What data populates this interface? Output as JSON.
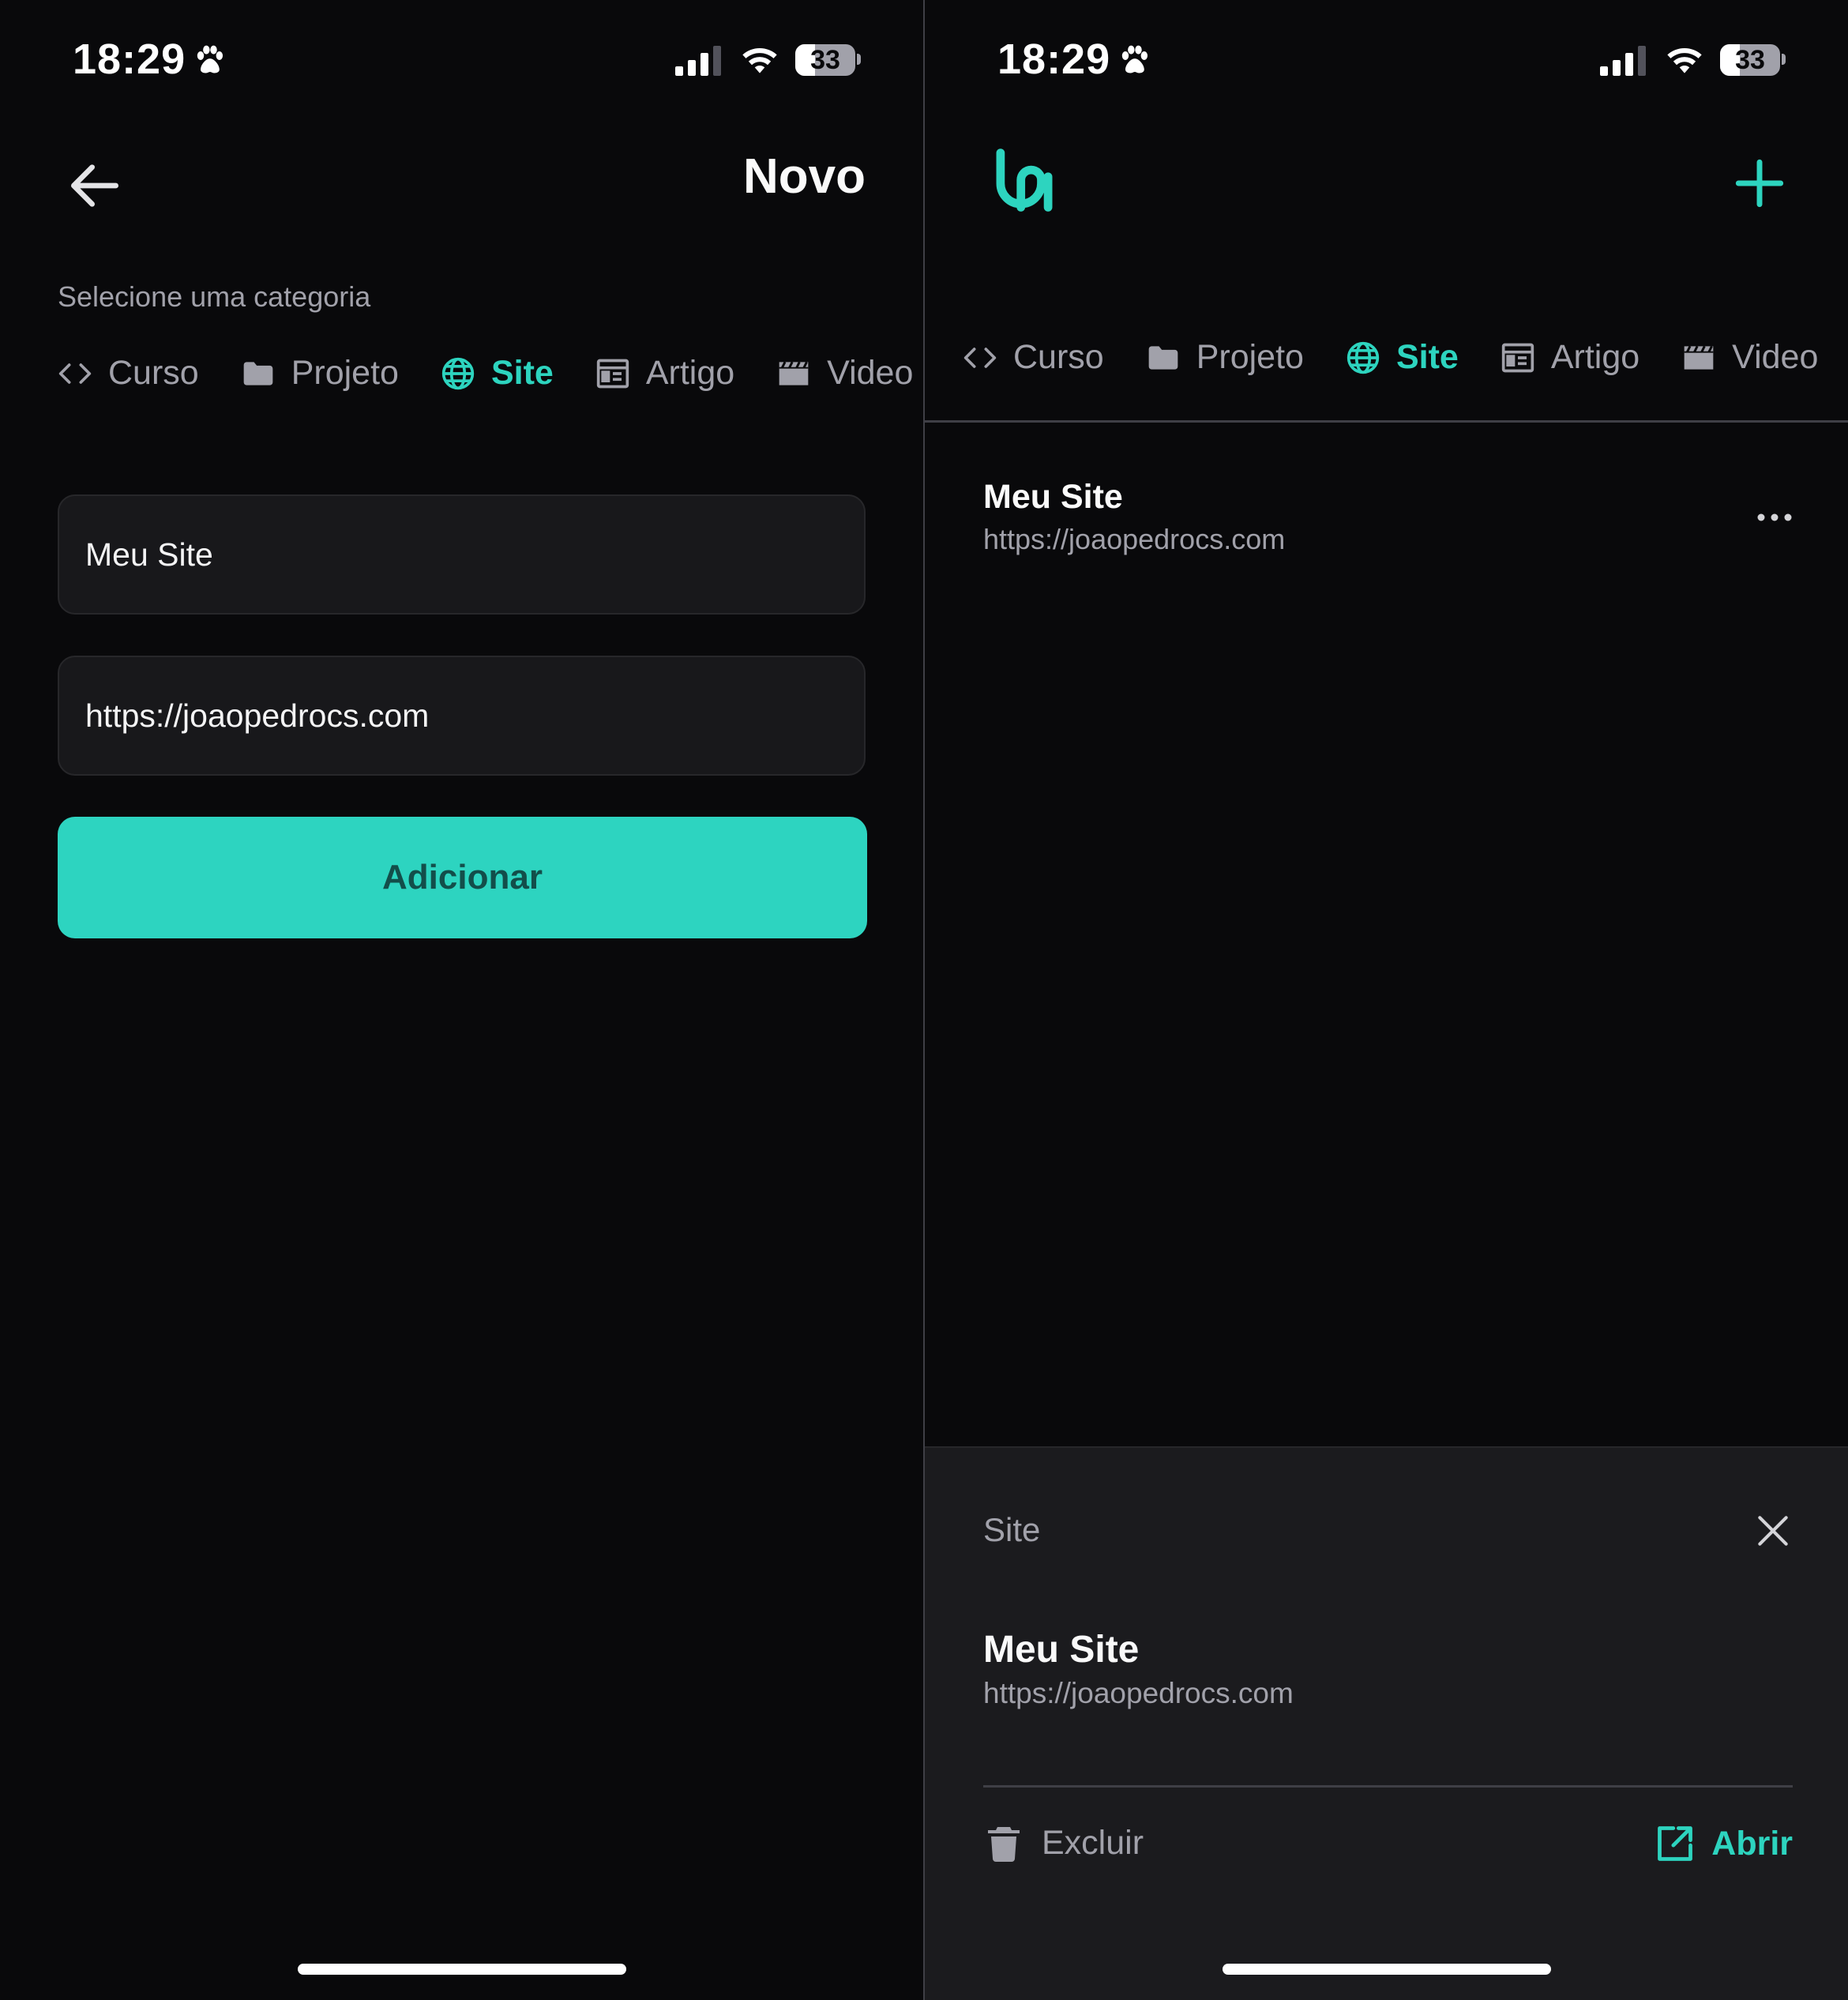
{
  "colors": {
    "accent": "#2dd4bf",
    "button_bg": "#2dd4c0",
    "background": "#09090b",
    "surface": "#18181b",
    "muted": "#a1a1aa"
  },
  "status_bar": {
    "time": "18:29",
    "battery": "33",
    "battery_level": 0.33
  },
  "left_screen": {
    "header_title": "Novo",
    "category_label": "Selecione uma categoria",
    "categories": [
      {
        "label": "Curso",
        "icon": "code-icon",
        "active": false
      },
      {
        "label": "Projeto",
        "icon": "folder-icon",
        "active": false
      },
      {
        "label": "Site",
        "icon": "globe-icon",
        "active": true
      },
      {
        "label": "Artigo",
        "icon": "newspaper-icon",
        "active": false
      },
      {
        "label": "Video",
        "icon": "clapperboard-icon",
        "active": false
      }
    ],
    "name_input_value": "Meu Site",
    "url_input_value": "https://joaopedrocs.com",
    "submit_label": "Adicionar"
  },
  "right_screen": {
    "categories": [
      {
        "label": "Curso",
        "icon": "code-icon",
        "active": false
      },
      {
        "label": "Projeto",
        "icon": "folder-icon",
        "active": false
      },
      {
        "label": "Site",
        "icon": "globe-icon",
        "active": true
      },
      {
        "label": "Artigo",
        "icon": "newspaper-icon",
        "active": false
      },
      {
        "label": "Video",
        "icon": "clapperboard-icon",
        "active": false
      }
    ],
    "items": [
      {
        "title": "Meu Site",
        "url": "https://joaopedrocs.com"
      }
    ],
    "sheet": {
      "category": "Site",
      "title": "Meu Site",
      "url": "https://joaopedrocs.com",
      "delete_label": "Excluir",
      "open_label": "Abrir"
    }
  }
}
